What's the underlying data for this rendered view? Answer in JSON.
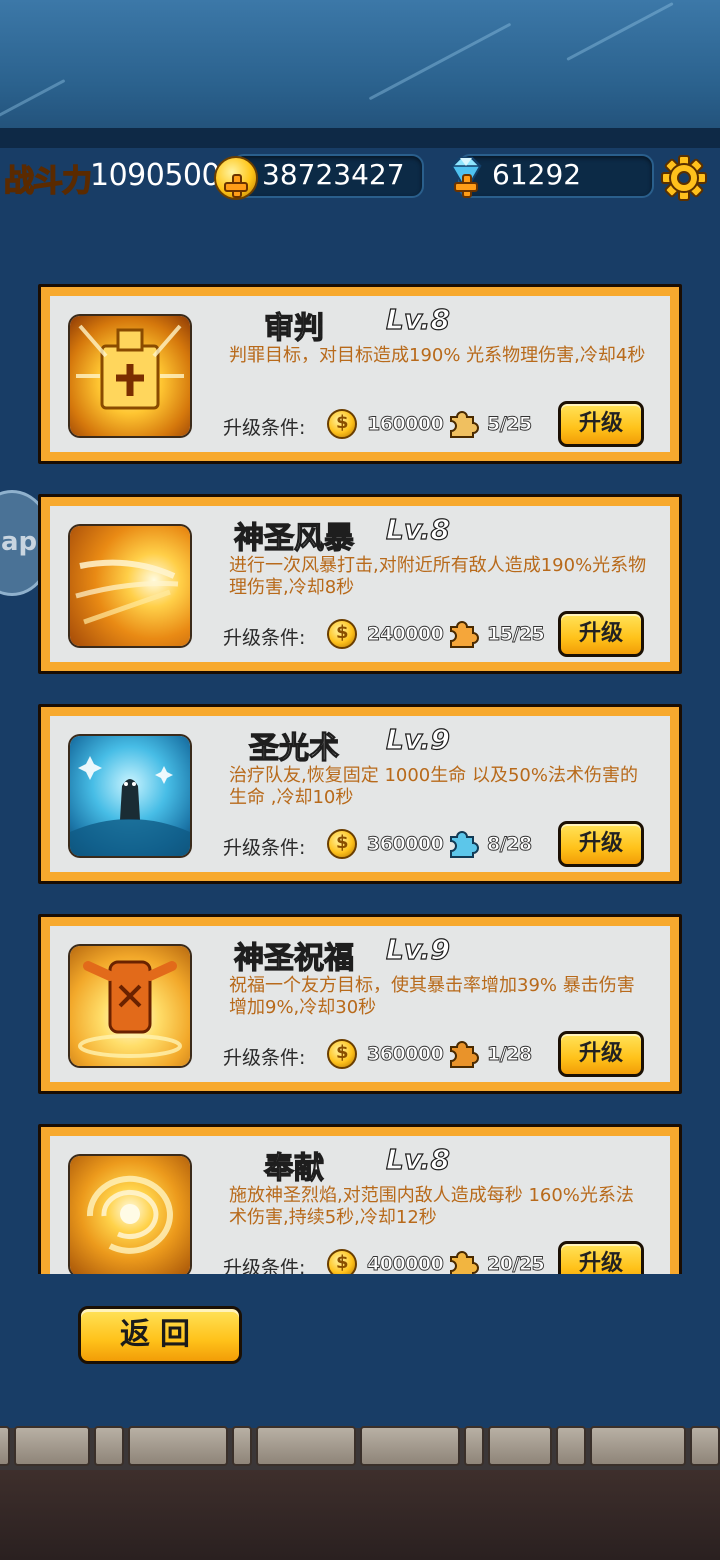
{
  "header": {
    "power_label": "战斗力",
    "power_value": "1090500",
    "gold_value": "38723427",
    "diamond_value": "61292",
    "icons": {
      "gold": "gold-coin-icon",
      "diamond": "diamond-icon",
      "add": "plus-icon",
      "settings": "gear-icon"
    }
  },
  "floating_button": {
    "label": "ap"
  },
  "skills": [
    {
      "name": "审判",
      "level": "Lv.8",
      "description": "判罪目标，对目标造成190% 光系物理伤害,冷却4秒",
      "req_label": "升级条件:",
      "gold_cost": "160000",
      "fragments": "5/25",
      "button": "升级",
      "icon": "judgement-skill-icon"
    },
    {
      "name": "神圣风暴",
      "level": "Lv.8",
      "description": "进行一次风暴打击,对附近所有敌人造成190%光系物理伤害,冷却8秒",
      "req_label": "升级条件:",
      "gold_cost": "240000",
      "fragments": "15/25",
      "button": "升级",
      "icon": "holy-storm-skill-icon"
    },
    {
      "name": "圣光术",
      "level": "Lv.9",
      "description": "治疗队友,恢复固定 1000生命 以及50%法术伤害的生命 ,冷却10秒",
      "req_label": "升级条件:",
      "gold_cost": "360000",
      "fragments": "8/28",
      "button": "升级",
      "icon": "holy-light-skill-icon"
    },
    {
      "name": "神圣祝福",
      "level": "Lv.9",
      "description": "祝福一个友方目标，使其暴击率增加39% 暴击伤害增加9%,冷却30秒",
      "req_label": "升级条件:",
      "gold_cost": "360000",
      "fragments": "1/28",
      "button": "升级",
      "icon": "holy-blessing-skill-icon"
    },
    {
      "name": "奉献",
      "level": "Lv.8",
      "description": "施放神圣烈焰,对范围内敌人造成每秒 160%光系法术伤害,持续5秒,冷却12秒",
      "req_label": "升级条件:",
      "gold_cost": "400000",
      "fragments": "20/25",
      "button": "升级",
      "icon": "consecration-skill-icon"
    }
  ],
  "footer": {
    "back_label": "返回"
  },
  "colors": {
    "card_border": "#f7a92e",
    "button_yellow": "#ffc21a",
    "description": "#b86a1b",
    "background": "#183d66"
  }
}
